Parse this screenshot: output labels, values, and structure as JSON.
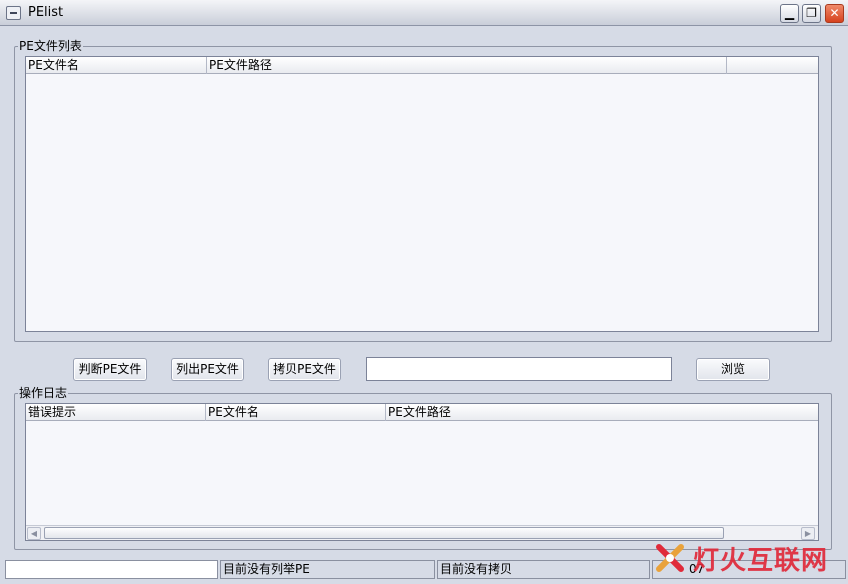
{
  "window": {
    "title": "PElist"
  },
  "pe_list_group": {
    "label": "PE文件列表",
    "columns": [
      "PE文件名",
      "PE文件路径",
      ""
    ]
  },
  "toolbar": {
    "check_pe": "判断PE文件",
    "list_pe": "列出PE文件",
    "copy_pe": "拷贝PE文件",
    "path_value": "",
    "browse": "浏览"
  },
  "log_group": {
    "label": "操作日志",
    "columns": [
      "错误提示",
      "PE文件名",
      "PE文件路径"
    ]
  },
  "statusbar": {
    "panel1": "",
    "panel2": "目前没有列举PE",
    "panel3": "目前没有拷贝",
    "panel4": "07"
  },
  "watermark": {
    "text": "灯火互联网",
    "logo": "x-logo"
  },
  "colors": {
    "window_bg": "#d6dbe6",
    "close_button": "#d6421e",
    "watermark": "#e02a3a"
  }
}
